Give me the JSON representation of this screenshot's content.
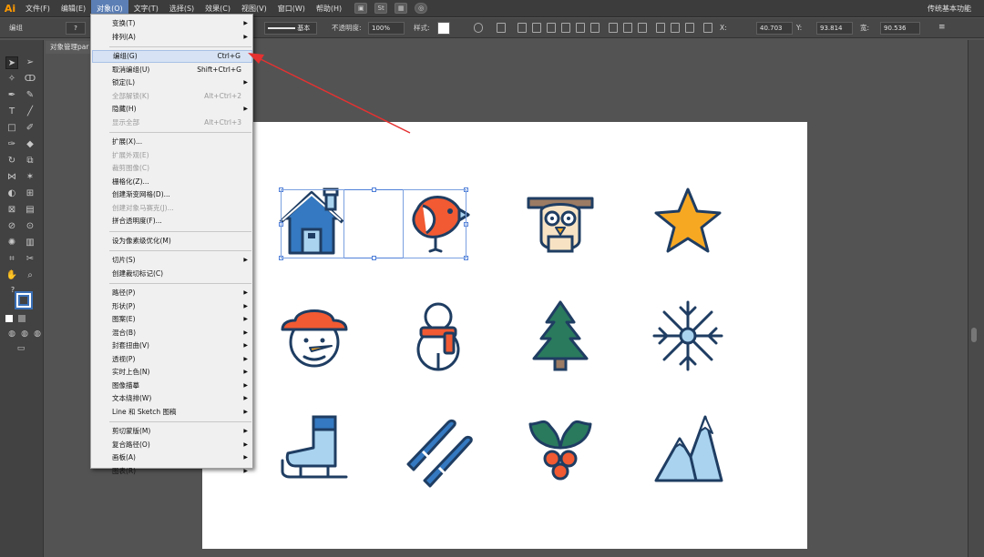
{
  "app": {
    "logo": "Ai",
    "workspace": "传统基本功能"
  },
  "menubar": {
    "items": [
      "文件(F)",
      "编辑(E)",
      "对象(O)",
      "文字(T)",
      "选择(S)",
      "效果(C)",
      "视图(V)",
      "窗口(W)",
      "帮助(H)"
    ],
    "active": "对象(O)",
    "st_label": "St"
  },
  "controlbar": {
    "group_label": "编组",
    "stroke_style": "基本",
    "opacity_label": "不透明度:",
    "opacity_value": "100%",
    "style_label": "样式:",
    "x_value": "40.703",
    "y_label": "Y:",
    "y_value": "93.814",
    "w_label": "宽:",
    "w_value": "90.536"
  },
  "document_tab": "对象管理par",
  "toolbar": {
    "help_icon": "?"
  },
  "object_menu": {
    "items": [
      {
        "label": "变换(T)",
        "submenu": true,
        "enabled": true
      },
      {
        "label": "排列(A)",
        "submenu": true,
        "enabled": true
      },
      {
        "separator": true
      },
      {
        "label": "编组(G)",
        "shortcut": "Ctrl+G",
        "enabled": true,
        "highlight": true
      },
      {
        "label": "取消编组(U)",
        "shortcut": "Shift+Ctrl+G",
        "enabled": true
      },
      {
        "label": "锁定(L)",
        "submenu": true,
        "enabled": true
      },
      {
        "label": "全部解锁(K)",
        "shortcut": "Alt+Ctrl+2",
        "enabled": false
      },
      {
        "label": "隐藏(H)",
        "submenu": true,
        "enabled": true
      },
      {
        "label": "显示全部",
        "shortcut": "Alt+Ctrl+3",
        "enabled": false
      },
      {
        "separator": true
      },
      {
        "label": "扩展(X)...",
        "enabled": true
      },
      {
        "label": "扩展外观(E)",
        "enabled": false
      },
      {
        "label": "裁剪图像(C)",
        "enabled": false
      },
      {
        "label": "栅格化(Z)...",
        "enabled": true
      },
      {
        "label": "创建渐变网格(D)...",
        "enabled": true
      },
      {
        "label": "创建对象马赛克(J)...",
        "enabled": false
      },
      {
        "label": "拼合透明度(F)...",
        "enabled": true
      },
      {
        "separator": true
      },
      {
        "label": "设为像素级优化(M)",
        "enabled": true
      },
      {
        "separator": true
      },
      {
        "label": "切片(S)",
        "submenu": true,
        "enabled": true
      },
      {
        "label": "创建裁切标记(C)",
        "enabled": true
      },
      {
        "separator": true
      },
      {
        "label": "路径(P)",
        "submenu": true,
        "enabled": true
      },
      {
        "label": "形状(P)",
        "submenu": true,
        "enabled": true
      },
      {
        "label": "图案(E)",
        "submenu": true,
        "enabled": true
      },
      {
        "label": "混合(B)",
        "submenu": true,
        "enabled": true
      },
      {
        "label": "封套扭曲(V)",
        "submenu": true,
        "enabled": true
      },
      {
        "label": "透视(P)",
        "submenu": true,
        "enabled": true
      },
      {
        "label": "实时上色(N)",
        "submenu": true,
        "enabled": true
      },
      {
        "label": "图像描摹",
        "submenu": true,
        "enabled": true
      },
      {
        "label": "文本绕排(W)",
        "submenu": true,
        "enabled": true
      },
      {
        "label": "Line 和 Sketch 图稿",
        "submenu": true,
        "enabled": true
      },
      {
        "separator": true
      },
      {
        "label": "剪切蒙版(M)",
        "submenu": true,
        "enabled": true
      },
      {
        "label": "复合路径(O)",
        "submenu": true,
        "enabled": true
      },
      {
        "label": "画板(A)",
        "submenu": true,
        "enabled": true
      },
      {
        "label": "图表(R)",
        "submenu": true,
        "enabled": true
      }
    ]
  },
  "artboard": {
    "icons": [
      "house-icon",
      "bird-icon",
      "owl-icon",
      "star-icon",
      "snowman-hat-icon",
      "snowman-scarf-icon",
      "pine-tree-icon",
      "snowflake-icon",
      "ice-skate-icon",
      "skis-icon",
      "holly-berries-icon",
      "mountains-icon"
    ]
  },
  "colors": {
    "outline": "#1f3d62",
    "orange": "#f15a32",
    "blue": "#3479c1",
    "light_blue": "#a9d3ef",
    "green": "#2a7a5e",
    "gold": "#f7a823",
    "tan": "#f7e3c4",
    "brown": "#9b7b63",
    "highlight_arrow": "#e53131"
  }
}
